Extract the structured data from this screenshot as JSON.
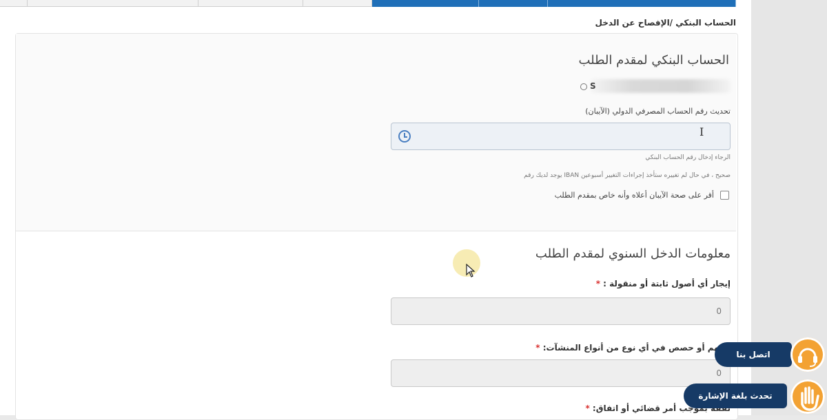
{
  "breadcrumb": "الحساب البنكي /الإفصاح عن الدخل",
  "bank_section": {
    "title": "الحساب البنكي لمقدم الطلب",
    "name_prefix": "S",
    "iban_label": "تحديث رقم الحساب المصرفي الدولي (الآيبان)",
    "iban_value": "",
    "hint1": "الرجاء إدخال رقم الحساب البنكي",
    "hint2": "صحيح ، في حال لم تغييره ستأخذ إجراءات التغيير أسبوعين IBAN يوجد لديك رقم",
    "confirm_label": "أقر على صحة الآيبان أعلاه وأنه خاص بمقدم الطلب"
  },
  "income_section": {
    "title": "معلومات الدخل السنوي لمقدم الطلب",
    "q1_label": "إيجار أي أصول ثابتة أو منقولة :",
    "q1_value": "0",
    "q2_label": "أسهم أو حصص في أي نوع من أنواع المنشآت:",
    "q2_value": "0",
    "q3_label": "نفقة بموجب أمر قضائي أو اتفاق:",
    "required_mark": "*"
  },
  "floating": {
    "contact_label": "اتصل بنا",
    "sign_label": "تحدث بلغة الإشارة"
  },
  "colors": {
    "accent": "#1f6fb8",
    "float_bg": "#163a66",
    "float_icon": "#f3a233",
    "required": "#d9302f"
  },
  "icons": [
    "clock-icon",
    "headset-icon",
    "hand-icon",
    "arrow-cursor-icon",
    "text-cursor-icon"
  ]
}
